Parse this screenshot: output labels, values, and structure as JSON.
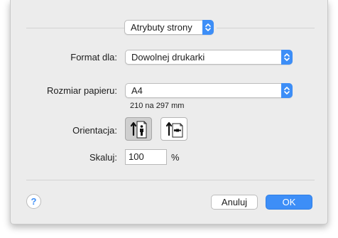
{
  "panel": {
    "label": "Atrybuty strony"
  },
  "format": {
    "label": "Format dla:",
    "value": "Dowolnej drukarki"
  },
  "paper": {
    "label": "Rozmiar papieru:",
    "value": "A4",
    "dimensions": "210 na 297 mm"
  },
  "orientation": {
    "label": "Orientacja:",
    "selected": "portrait",
    "options": [
      "portrait",
      "landscape"
    ]
  },
  "scale": {
    "label": "Skaluj:",
    "value": "100",
    "unit": "%"
  },
  "buttons": {
    "help": "?",
    "cancel": "Anuluj",
    "ok": "OK"
  },
  "colors": {
    "accent": "#3d8ef7",
    "background": "#ececec"
  }
}
